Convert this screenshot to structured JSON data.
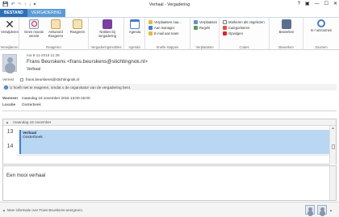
{
  "window": {
    "title": "Verhaal - Vergadering",
    "controls": {
      "help": "?",
      "restore": "▣",
      "minimize": "—",
      "maximize": "☐",
      "close": "✕"
    },
    "qat": {
      "save": "💾",
      "undo": "↶",
      "redo": "↷",
      "up": "↑",
      "down": "↓",
      "more": "▾"
    }
  },
  "tabs": [
    {
      "label": "BESTAND"
    },
    {
      "label": "VERGADERING"
    }
  ],
  "ribbon": {
    "groups": {
      "delete": "Verwijderen",
      "respond": "Reageren",
      "meeting_notes": "Vergaderingsnotities",
      "calendar": "Agenda",
      "quick_steps": "Snelle stappen",
      "move": "Verplaatsen",
      "tags": "Codes",
      "edit": "Bewerken",
      "zoom": "Zoomen"
    },
    "buttons": {
      "delete": "Verwijderen",
      "no_response": "Geen reactie vereist",
      "respond": "Antwoord",
      "respond_sub": "Reageren",
      "react": "Reageren",
      "notes": "Notities bij vergadering",
      "calendar": "Agenda",
      "move_to": "Verplaatsen naa...",
      "to_manager": "Aan manager",
      "email_team": "E-mail aan team",
      "move": "Verplaatsen",
      "rules": "Regels",
      "mark_unread": "Markeren als ongelezen",
      "categorize": "Categoriseren",
      "follow_up": "Opvolgen",
      "edit": "Bewerken",
      "zoom": "In-/ uitzoomen"
    }
  },
  "header": {
    "date": "ma 9-11-2015 11:29",
    "from": "Frans Beurskens <frans.beurskens@stichtingnok.nl>",
    "subject": "Verhaal",
    "required_label": "Vereist",
    "required_value": "frans.beurskens@stichtingnok.nl",
    "info": "U hoeft niet te reageren, omdat u de organisator van de vergadering bent.",
    "when_label": "Wanneer",
    "when_value": "maandag 16 november 2015 13:00-15:00",
    "location_label": "Locatie",
    "location_value": "Oosterbeek"
  },
  "calendar": {
    "day_header": "maandag 16 november",
    "hours": [
      "13",
      "14"
    ],
    "event_title": "Verhaal",
    "event_location": "Oosterbeek",
    "collapse": "▲"
  },
  "body": {
    "text": "Een mooi verhaal"
  },
  "status": {
    "people_info": "Meer informatie over Frans Beurskens weergeven."
  },
  "icons": {
    "delete": "x-icon",
    "no_response": "no-response-icon",
    "respond": "reply-icon",
    "react": "reply-all-icon",
    "notes": "onenote-icon",
    "calendar": "calendar-icon"
  },
  "colors": {
    "accent": "#2e6fb6",
    "event": "#b9d6f2"
  }
}
